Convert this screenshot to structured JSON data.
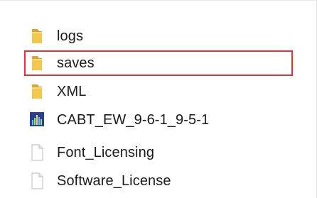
{
  "explorer": {
    "items": [
      {
        "name": "logs",
        "type": "folder",
        "icon": "folder-icon"
      },
      {
        "name": "saves",
        "type": "folder",
        "icon": "folder-icon",
        "highlighted": true
      },
      {
        "name": "XML",
        "type": "folder",
        "icon": "folder-icon"
      },
      {
        "name": "CABT_EW_9-6-1_9-5-1",
        "type": "application",
        "icon": "app-chart-icon"
      },
      {
        "name": "Font_Licensing",
        "type": "document",
        "icon": "document-icon"
      },
      {
        "name": "Software_License",
        "type": "document",
        "icon": "document-icon"
      }
    ],
    "colors": {
      "folder": "#f2c94c",
      "folder_dark": "#dca52e",
      "highlight_border": "#e0323b",
      "app_icon_bg": "#2b3f8f",
      "document": "#cfcfcf"
    }
  }
}
